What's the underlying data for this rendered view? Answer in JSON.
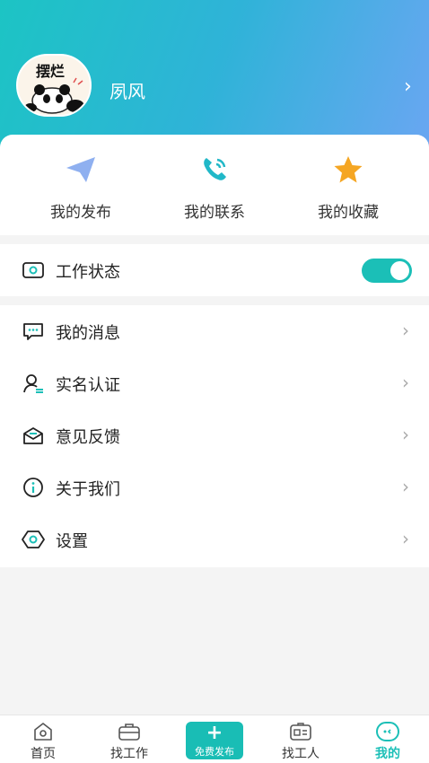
{
  "profile": {
    "name": "夙风",
    "avatar_caption": "摆烂"
  },
  "quick_actions": [
    {
      "label": "我的发布",
      "icon": "paper-plane-icon"
    },
    {
      "label": "我的联系",
      "icon": "phone-icon"
    },
    {
      "label": "我的收藏",
      "icon": "star-icon"
    }
  ],
  "work_status": {
    "label": "工作状态",
    "enabled": true
  },
  "menu": [
    {
      "label": "我的消息",
      "icon": "message-icon"
    },
    {
      "label": "实名认证",
      "icon": "user-verify-icon"
    },
    {
      "label": "意见反馈",
      "icon": "mail-icon"
    },
    {
      "label": "关于我们",
      "icon": "info-icon"
    },
    {
      "label": "设置",
      "icon": "settings-icon"
    }
  ],
  "tabs": [
    {
      "label": "首页",
      "icon": "home-icon"
    },
    {
      "label": "找工作",
      "icon": "briefcase-icon"
    },
    {
      "label": "找工人",
      "icon": "id-card-icon"
    },
    {
      "label": "我的",
      "icon": "profile-icon",
      "active": true
    }
  ],
  "publish": {
    "plus": "+",
    "label": "免费发布"
  },
  "colors": {
    "accent": "#1bbfb7",
    "header_start": "#1cc4c4",
    "header_end": "#6aa6f2",
    "star": "#f5a623"
  }
}
